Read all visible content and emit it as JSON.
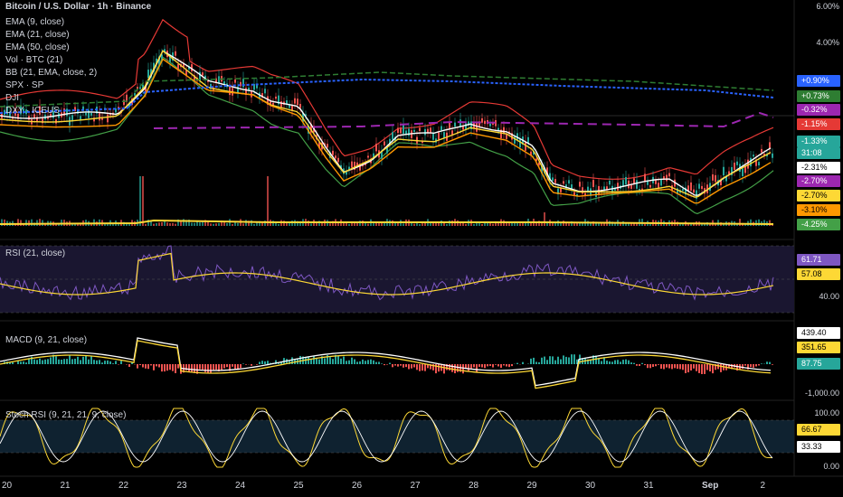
{
  "title": "Bitcoin / U.S. Dollar · 1h · Binance",
  "indicators": [
    "EMA (9, close)",
    "EMA (21, close)",
    "EMA (50, close)",
    "Vol · BTC (21)",
    "BB (21, EMA, close, 2)",
    "SPX · SP",
    "DJI",
    "DXY · ICEUS"
  ],
  "main_scale": [
    "6.00%",
    "4.00%"
  ],
  "main_tags": [
    {
      "text": "+0.90%",
      "color": "#2962ff"
    },
    {
      "text": "+0.73%",
      "color": "#2e7d32"
    },
    {
      "text": "-0.32%",
      "color": "#9c27b0"
    },
    {
      "text": "-1.15%",
      "color": "#e53935"
    },
    {
      "text": "-1.33%",
      "color": "#26a69a"
    },
    {
      "text": "31:08",
      "color": "#26a69a"
    },
    {
      "text": "-2.31%",
      "color": "#ffffff"
    },
    {
      "text": "-2.70%",
      "color": "#9c27b0"
    },
    {
      "text": "-2.70%",
      "color": "#fdd835"
    },
    {
      "text": "-3.10%",
      "color": "#ff9800"
    },
    {
      "text": "-4.25%",
      "color": "#43a047"
    }
  ],
  "rsi": {
    "title": "RSI (21, close)",
    "tag_rsi": "61.71",
    "tag_ma": "57.08",
    "scale": "40.00"
  },
  "macd": {
    "title": "MACD (9, 21, close)",
    "tag_macd": "439.40",
    "tag_signal": "351.65",
    "tag_hist": "87.75",
    "scale": "-1,000.00"
  },
  "stoch": {
    "title": "Stoch RSI (9, 21, 21, 9, close)",
    "scale_top": "100.00",
    "tag_k": "66.67",
    "tag_d": "33.33",
    "scale_bottom": "0.00"
  },
  "x_axis": [
    "20",
    "21",
    "22",
    "23",
    "24",
    "25",
    "26",
    "27",
    "28",
    "29",
    "30",
    "31",
    "Sep",
    "2"
  ],
  "colors": {
    "up": "#26a69a",
    "down": "#ef5350",
    "ema9": "#ffffff",
    "ema21": "#fdd835",
    "ema50": "#ff9800",
    "bb_upper": "#e53935",
    "bb_lower": "#43a047",
    "spx": "#2962ff",
    "dji": "#2e7d32",
    "dxy": "#9c27b0",
    "rsi": "#7e57c2",
    "rsi_ma": "#fdd835"
  }
}
